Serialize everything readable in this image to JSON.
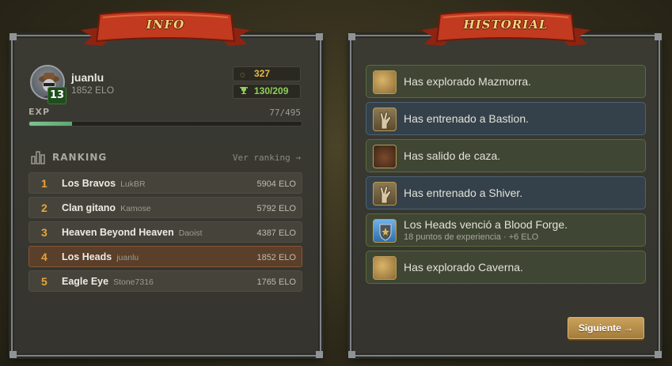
{
  "info": {
    "banner": "INFO",
    "profile": {
      "username": "juanlu",
      "elo": "1852 ELO",
      "level": "13"
    },
    "stats": {
      "coins": "327",
      "trophies": "130/209",
      "coin_icon": "coin-icon",
      "trophy_icon": "trophy-icon"
    },
    "exp": {
      "label": "EXP",
      "value": "77/495",
      "progress": 0.156
    },
    "ranking": {
      "title": "RANKING",
      "link": "Ver ranking →",
      "rows": [
        {
          "pos": "1",
          "name": "Los Bravos",
          "leader": "LukBR",
          "score": "5904 ELO"
        },
        {
          "pos": "2",
          "name": "Clan gitano",
          "leader": "Kamose",
          "score": "5792 ELO"
        },
        {
          "pos": "3",
          "name": "Heaven Beyond Heaven",
          "leader": "Daoist",
          "score": "4387 ELO"
        },
        {
          "pos": "4",
          "name": "Los Heads",
          "leader": "juanlu",
          "score": "1852 ELO"
        },
        {
          "pos": "5",
          "name": "Eagle Eye",
          "leader": "Stone7316",
          "score": "1765 ELO"
        }
      ]
    }
  },
  "historial": {
    "banner": "HISTORIAL",
    "items": [
      {
        "text": "Has explorado Mazmorra.",
        "icon": "map-icon"
      },
      {
        "text": "Has entrenado a Bastion.",
        "icon": "hand-icon"
      },
      {
        "text": "Has salido de caza.",
        "icon": "hunt-icon"
      },
      {
        "text": "Has entrenado a Shiver.",
        "icon": "hand-icon"
      },
      {
        "text": "Los Heads venció a Blood Forge.",
        "sub": "18 puntos de experiencia · +6 ELO",
        "icon": "shield-icon"
      },
      {
        "text": "Has explorado Caverna.",
        "icon": "map-icon"
      }
    ],
    "next_label": "Siguiente →"
  },
  "colors": {
    "banner_red": "#b8321b",
    "gold": "#e8a43c",
    "green": "#8fd05a"
  }
}
